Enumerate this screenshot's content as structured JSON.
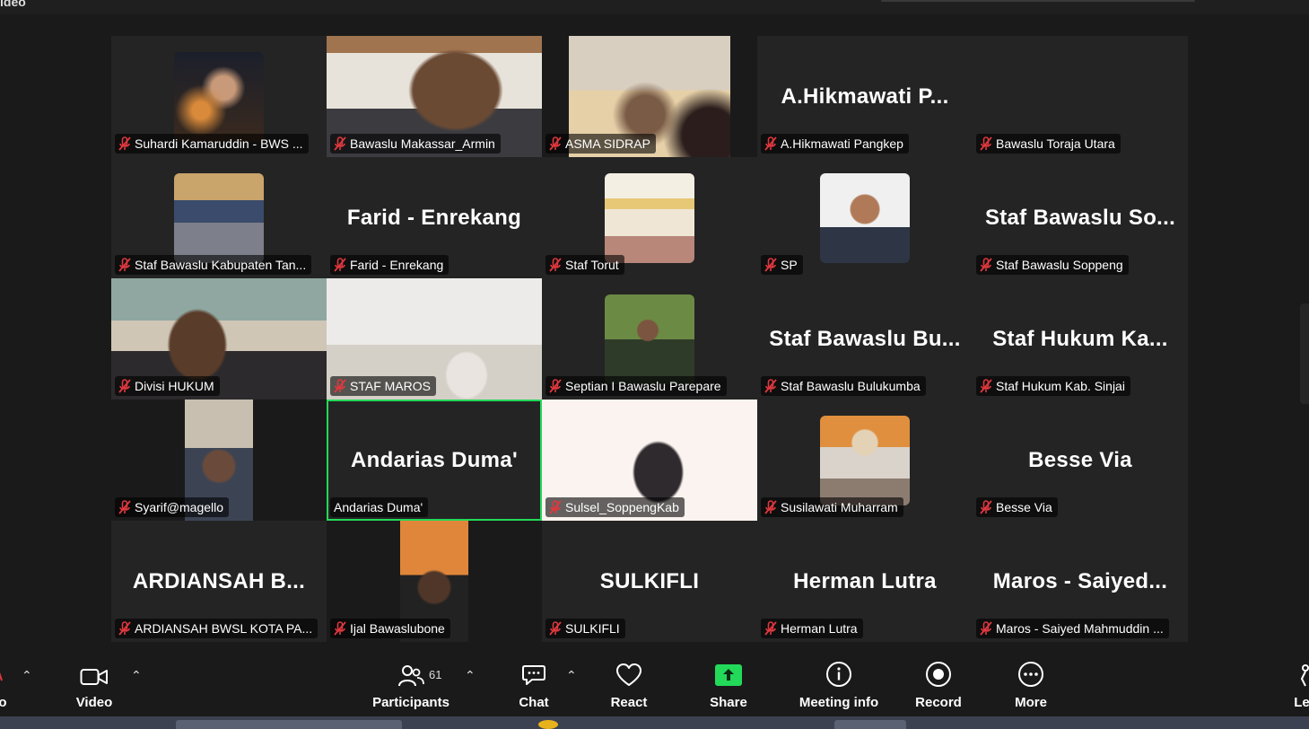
{
  "window": {
    "title": "ideo"
  },
  "participants": [
    {
      "name": "Suhardi Kamaruddin - BWS ...",
      "display": "",
      "video": "photo-night",
      "muted": true
    },
    {
      "name": "Bawaslu Makassar_Armin",
      "display": "",
      "video": "full-makassar",
      "muted": true
    },
    {
      "name": "ASMA SIDRAP",
      "display": "",
      "video": "photo-sidrap",
      "muted": true
    },
    {
      "name": "A.Hikmawati  Pangkep",
      "display": "A.Hikmawati  P...",
      "video": "",
      "muted": true
    },
    {
      "name": "Bawaslu Toraja Utara",
      "display": "",
      "video": "",
      "muted": true
    },
    {
      "name": "Staf Bawaslu Kabupaten Tan...",
      "display": "",
      "video": "photo-group",
      "muted": true
    },
    {
      "name": "Farid - Enrekang",
      "display": "Farid - Enrekang",
      "video": "",
      "muted": true
    },
    {
      "name": "Staf Torut",
      "display": "",
      "video": "photo-poster",
      "muted": true
    },
    {
      "name": "SP",
      "display": "",
      "video": "photo-portrait",
      "muted": true
    },
    {
      "name": "Staf Bawaslu Soppeng",
      "display": "Staf  Bawaslu  So...",
      "video": "",
      "muted": true
    },
    {
      "name": "Divisi HUKUM",
      "display": "",
      "video": "full-hukum",
      "muted": true
    },
    {
      "name": "STAF MAROS",
      "display": "",
      "video": "full-maros",
      "muted": true
    },
    {
      "name": "Septian I Bawaslu Parepare",
      "display": "",
      "video": "photo-forest",
      "muted": true
    },
    {
      "name": "Staf Bawaslu Bulukumba",
      "display": "Staf  Bawaslu  Bu...",
      "video": "",
      "muted": true
    },
    {
      "name": "Staf Hukum Kab. Sinjai",
      "display": "Staf  Hukum  Ka...",
      "video": "",
      "muted": true
    },
    {
      "name": "Syarif@magello",
      "display": "",
      "video": "photo-man",
      "muted": true
    },
    {
      "name": "Andarias Duma'",
      "display": "Andarias Duma'",
      "video": "",
      "muted": false,
      "active": true
    },
    {
      "name": "Sulsel_SoppengKab",
      "display": "",
      "video": "full-soppeng",
      "muted": true
    },
    {
      "name": "Susilawati Muharram",
      "display": "",
      "video": "photo-selfie",
      "muted": true
    },
    {
      "name": "Besse Via",
      "display": "Besse Via",
      "video": "",
      "muted": true
    },
    {
      "name": "ARDIANSAH BWSL KOTA PA...",
      "display": "ARDIANSAH  B...",
      "video": "",
      "muted": true
    },
    {
      "name": "Ijal Bawaslubone",
      "display": "",
      "video": "photo-ijal",
      "muted": true
    },
    {
      "name": "SULKIFLI",
      "display": "SULKIFLI",
      "video": "",
      "muted": true
    },
    {
      "name": "Herman Lutra",
      "display": "Herman Lutra",
      "video": "",
      "muted": true
    },
    {
      "name": "Maros - Saiyed Mahmuddin ...",
      "display": "Maros  -  Saiyed...",
      "video": "",
      "muted": true
    }
  ],
  "toolbar": {
    "audio": {
      "label": "o"
    },
    "video": {
      "label": "Video"
    },
    "participants": {
      "label": "Participants",
      "count": "61"
    },
    "chat": {
      "label": "Chat"
    },
    "react": {
      "label": "React"
    },
    "share": {
      "label": "Share",
      "color": "#23d959"
    },
    "meeting_info": {
      "label": "Meeting info"
    },
    "record": {
      "label": "Record"
    },
    "more": {
      "label": "More"
    },
    "leave": {
      "label": "Le"
    }
  },
  "colors": {
    "active_speaker": "#23d959",
    "muted_icon": "#e0383e",
    "background": "#1a1a1a",
    "tile": "#242424"
  }
}
